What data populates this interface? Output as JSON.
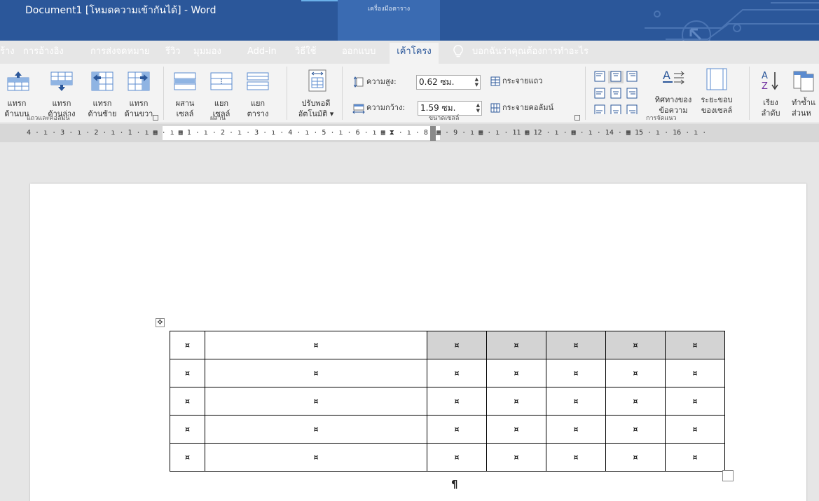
{
  "window": {
    "title": "Document1 [โหมดความเข้ากันได้]  -  Word",
    "contextual_tab_group": "เครื่องมือตาราง"
  },
  "tabs": [
    {
      "label": "ร้าง",
      "active": false
    },
    {
      "label": "การอ้างอิง",
      "active": false
    },
    {
      "label": "การส่งจดหมาย",
      "active": false
    },
    {
      "label": "รีวิว",
      "active": false
    },
    {
      "label": "มุมมอง",
      "active": false
    },
    {
      "label": "Add-in",
      "active": false
    },
    {
      "label": "วิธีใช้",
      "active": false
    },
    {
      "label": "ออกแบบ",
      "active": false
    },
    {
      "label": "เค้าโครง",
      "active": true
    }
  ],
  "tell_me": {
    "text": "บอกฉันว่าคุณต้องการทำอะไร",
    "icon": "lightbulb-icon"
  },
  "ribbon": {
    "rows_columns": {
      "group_label": "แถวและคอลัมน์",
      "insert_above": {
        "line1": "แทรก",
        "line2": "ด้านบน"
      },
      "insert_below": {
        "line1": "แทรก",
        "line2": "ด้านล่าง"
      },
      "insert_left": {
        "line1": "แทรก",
        "line2": "ด้านซ้าย"
      },
      "insert_right": {
        "line1": "แทรก",
        "line2": "ด้านขวา"
      }
    },
    "merge": {
      "group_label": "ผสาน",
      "merge_cells": {
        "line1": "ผสาน",
        "line2": "เซลล์"
      },
      "split_cells": {
        "line1": "แยก",
        "line2": "เซลล์"
      },
      "split_table": {
        "line1": "แยก",
        "line2": "ตาราง"
      }
    },
    "autofit": {
      "line1": "ปรับพอดี",
      "line2": "อัตโนมัติ"
    },
    "cell_size": {
      "group_label": "ขนาดเซลล์",
      "height_label": "ความสูง:",
      "height_value": "0.62 ซม.",
      "width_label": "ความกว้าง:",
      "width_value": "1.59 ซม.",
      "distribute_rows": "กระจายแถว",
      "distribute_columns": "กระจายคอลัมน์"
    },
    "alignment": {
      "group_label": "การจัดแนว",
      "text_direction": {
        "line1": "ทิศทางของ",
        "line2": "ข้อความ"
      },
      "cell_margins": {
        "line1": "ระยะขอบ",
        "line2": "ของเซลล์"
      }
    },
    "data": {
      "sort": {
        "line1": "เรียง",
        "line2": "ลำดับ"
      },
      "repeat_header": {
        "line1": "ทำซ้ำแ",
        "line2": "ส่วนห"
      }
    }
  },
  "ruler": {
    "text": "4 · ı · 3 · ı · 2 · ı · 1 · ı ▦ · ı ▦ 1 · ı · 2 · ı · 3 · ı · 4 · ı · 5 · ı · 6 · ı ▦ ⧗ · ı · 8 ▲▦ · 9 · ı ▦ · ı · 11 ▦ 12 · ı · ▦ · ı · 14 · ▦ 15 · ı · 16 · ı ·"
  },
  "document": {
    "end_cell_mark": "¤",
    "paragraph_mark": "¶",
    "table": {
      "rows": [
        {
          "cells": [
            "¤",
            "¤",
            "¤",
            "¤",
            "¤",
            "¤",
            "¤"
          ]
        },
        {
          "cells": [
            "¤",
            "¤",
            "¤",
            "¤",
            "¤",
            "¤",
            "¤"
          ]
        },
        {
          "cells": [
            "¤",
            "¤",
            "¤",
            "¤",
            "¤",
            "¤",
            "¤"
          ]
        },
        {
          "cells": [
            "¤",
            "¤",
            "¤",
            "¤",
            "¤",
            "¤",
            "¤"
          ]
        },
        {
          "cells": [
            "¤",
            "¤",
            "¤",
            "¤",
            "¤",
            "¤",
            "¤"
          ]
        }
      ],
      "selected_row": 0,
      "selected_from_col": 2
    }
  }
}
